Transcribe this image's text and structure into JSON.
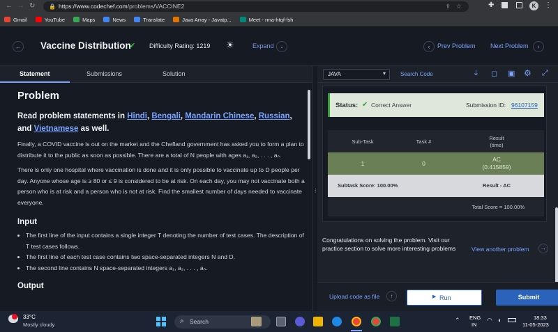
{
  "browser": {
    "url_host": "https://www.codechef.com",
    "url_path": "/problems/VACCINE2",
    "profile_letter": "K",
    "bookmarks": [
      {
        "label": "Gmail",
        "color": "#ea4335"
      },
      {
        "label": "YouTube",
        "color": "#ff0000"
      },
      {
        "label": "Maps",
        "color": "#34a853"
      },
      {
        "label": "News",
        "color": "#4285f4"
      },
      {
        "label": "Translate",
        "color": "#4285f4"
      },
      {
        "label": "Java Array - Javatp...",
        "color": "#e37400"
      },
      {
        "label": "Meet - rma-htqf-fsh",
        "color": "#00897b"
      }
    ]
  },
  "header": {
    "title": "Vaccine Distribution",
    "check": "✔",
    "difficulty": "Difficulty Rating: 1219",
    "expand": "Expand",
    "prev": "Prev Problem",
    "next": "Next Problem"
  },
  "tabs": {
    "statement": "Statement",
    "submissions": "Submissions",
    "solution": "Solution"
  },
  "toolbar": {
    "language": "JAVA",
    "search_code": "Search Code"
  },
  "problem": {
    "heading": "Problem",
    "read_prefix": "Read problem statements in ",
    "langs": [
      "Hindi",
      "Bengali",
      "Mandarin Chinese",
      "Russian"
    ],
    "and": "and",
    "lang_last": "Vietnamese",
    "read_suffix": " as well.",
    "p1": "Finally, a COVID vaccine is out on the market and the Chefland government has asked you to form a plan to distribute it to the public as soon as possible. There are a total of N people with ages a₁, a₂, . . . , aₙ.",
    "p2": "There is only one hospital where vaccination is done and it is only possible to vaccinate up to D people per day. Anyone whose age is ≥ 80 or ≤ 9 is considered to be at risk. On each day, you may not vaccinate both a person who is at risk and a person who is not at risk. Find the smallest number of days needed to vaccinate everyone.",
    "input_heading": "Input",
    "input_items": [
      "The first line of the input contains a single integer T denoting the number of test cases. The description of T test cases follows.",
      "The first line of each test case contains two space-separated integers N and D.",
      "The second line contains N space-separated integers a₁, a₂, . . . , aₙ."
    ],
    "output_heading": "Output"
  },
  "result": {
    "status_label": "Status:",
    "status_value": "Correct Answer",
    "submission_label": "Submission ID:",
    "submission_id": "96107159",
    "col_subtask": "Sub-Task",
    "col_task": "Task #",
    "col_result": "Result",
    "col_result_sub": "(time)",
    "row_subtask": "1",
    "row_task": "0",
    "row_result": "AC",
    "row_time": "(0.415859)",
    "subtask_score": "Subtask Score: 100.00%",
    "result_ac": "Result - AC",
    "total_score": "Total Score = 100.00%",
    "congrats": "Congratulations on solving the problem. Visit our practice section to solve more interesting problems",
    "view_another": "View another problem",
    "upload": "Upload code as file",
    "run": "Run",
    "submit": "Submit"
  },
  "taskbar": {
    "temp": "33°C",
    "weather": "Mostly cloudy",
    "search": "Search",
    "lang1": "ENG",
    "lang2": "IN",
    "time": "18:33",
    "date": "11-05-2023"
  },
  "colors": {
    "accent": "#7ba3ff",
    "success": "#37c237",
    "green_row": "#6b7f56",
    "submit": "#2a63b9"
  }
}
